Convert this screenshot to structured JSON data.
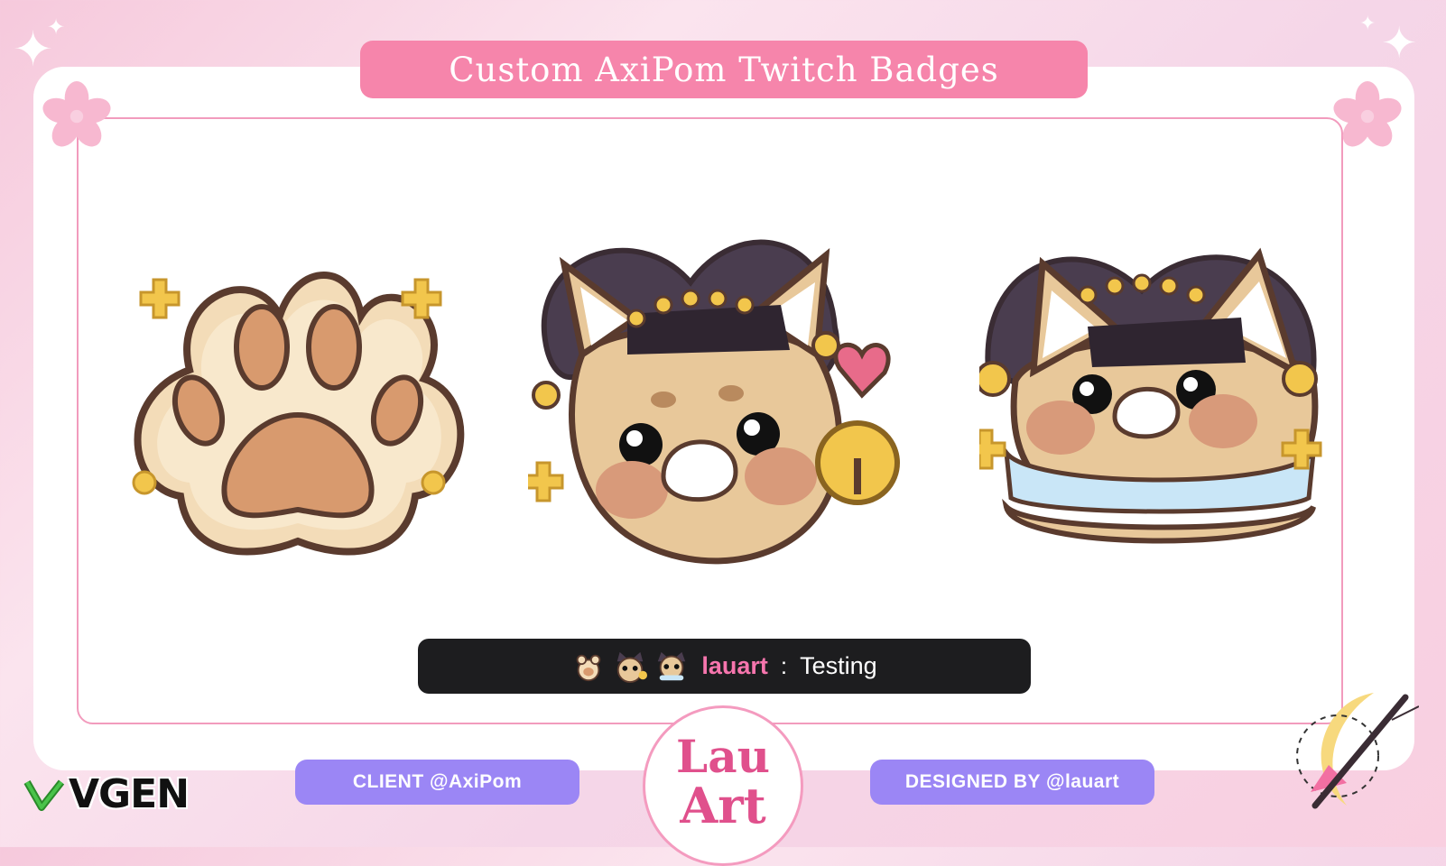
{
  "header": {
    "title": "Custom AxiPom Twitch Badges"
  },
  "badges": [
    {
      "name": "paw-badge",
      "icon": "paw-icon"
    },
    {
      "name": "cat-jester-badge",
      "icon": "cat-jester-icon"
    },
    {
      "name": "cat-jester-ruffle-badge",
      "icon": "cat-jester-ruffle-icon"
    }
  ],
  "chat_preview": {
    "username": "lauart",
    "separator": ":",
    "message": "Testing"
  },
  "footer": {
    "client_label": "CLIENT @AxiPom",
    "designer_label": "DESIGNED BY @lauart",
    "logo_line1": "Lau",
    "logo_line2": "Art",
    "vgen_label": "VGEN"
  },
  "colors": {
    "title_bg": "#f685ab",
    "frame_border": "#f29bbd",
    "pill_bg": "#9b86f5",
    "chat_bg": "#1d1d1f",
    "username": "#f675ad",
    "badge_beige": "#f3dcb8",
    "badge_outline": "#5a3b2e",
    "gold": "#f2c64c"
  }
}
